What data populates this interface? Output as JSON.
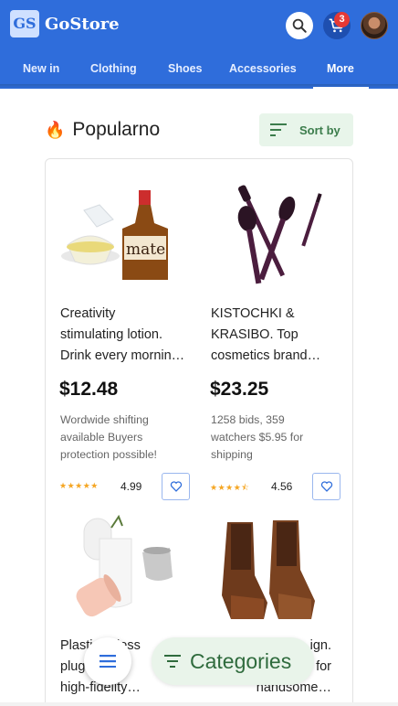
{
  "app": {
    "logo_text": "GS",
    "brand": "GoStore"
  },
  "header": {
    "cart_count": "3"
  },
  "nav": [
    {
      "label": "New in"
    },
    {
      "label": "Clothing"
    },
    {
      "label": "Shoes"
    },
    {
      "label": "Accessories"
    },
    {
      "label": "More"
    }
  ],
  "section": {
    "title": "Popularno",
    "sort_label": "Sort by"
  },
  "products": [
    {
      "title_line1": "Creativity",
      "title_line2": "stimulating lotion.",
      "title_line3": "Drink every mornin…",
      "price": "$12.48",
      "ship_line1": "Wordwide shifting",
      "ship_line2": "available Buyers",
      "ship_line3": "protection possible!",
      "rating": "4.99",
      "stars": "★★★★★",
      "image": "lotion-bottle-image"
    },
    {
      "title_line1": "KISTOCHKI &",
      "title_line2": "KRASIBO. Top",
      "title_line3": "cosmetics brand…",
      "price": "$23.25",
      "ship_line1": "1258 bids, 359",
      "ship_line2": "watchers $5.95 for",
      "ship_line3": "shipping",
      "rating": "4.56",
      "stars": "★★★★⯪",
      "image": "makeup-brushes-image"
    },
    {
      "title_line1": "Plasti… eless",
      "title_line2": "plug… ube",
      "title_line3": "high-fidelity…",
      "image": "ceramic-vases-image"
    },
    {
      "title_line1": "…ign.",
      "title_line2": "… for",
      "title_line3": "handsome…",
      "image": "leather-boots-image"
    }
  ],
  "fab": {
    "categories_label": "Categories"
  },
  "colors": {
    "primary": "#2f6ddb",
    "accent_green": "#3c7d4c",
    "star": "#f5a623",
    "badge": "#e53935"
  }
}
